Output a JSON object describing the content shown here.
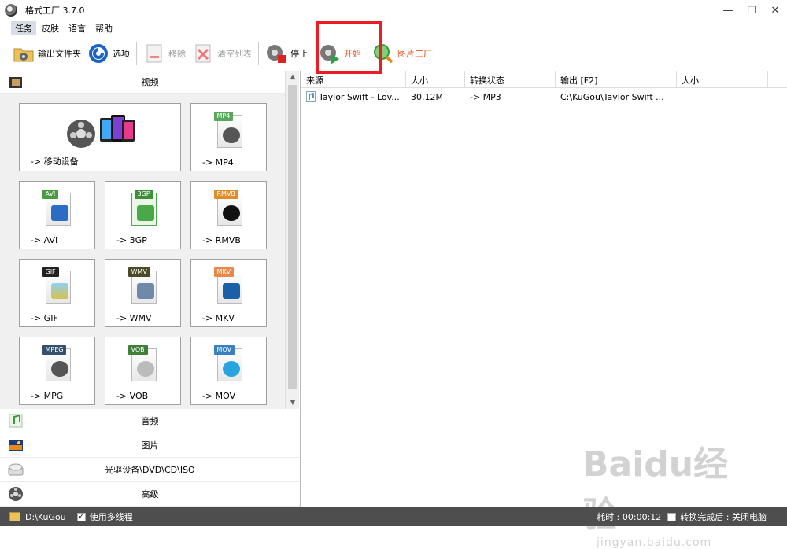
{
  "window": {
    "title": "格式工厂 3.7.0",
    "min": "—",
    "max": "☐",
    "close": "✕"
  },
  "menu": [
    "任务",
    "皮肤",
    "语言",
    "帮助"
  ],
  "toolbar": {
    "output_folder": "输出文件夹",
    "options": "选项",
    "remove": "移除",
    "clear_list": "清空列表",
    "stop": "停止",
    "start": "开始",
    "picture_factory": "图片工厂"
  },
  "left": {
    "video_header": "视频",
    "tiles": [
      {
        "label": "-> 移动设备",
        "tag": ""
      },
      {
        "label": "-> MP4",
        "tag": "MP4"
      },
      {
        "label": "-> AVI",
        "tag": "AVI"
      },
      {
        "label": "-> 3GP",
        "tag": "3GP"
      },
      {
        "label": "-> RMVB",
        "tag": "RMVB"
      },
      {
        "label": "-> GIF",
        "tag": "GIF"
      },
      {
        "label": "-> WMV",
        "tag": "WMV"
      },
      {
        "label": "-> MKV",
        "tag": "MKV"
      },
      {
        "label": "-> MPG",
        "tag": "MPEG"
      },
      {
        "label": "-> VOB",
        "tag": "VOB"
      },
      {
        "label": "-> MOV",
        "tag": "MOV"
      }
    ],
    "categories": [
      "音频",
      "图片",
      "光驱设备\\DVD\\CD\\ISO",
      "高级"
    ]
  },
  "table": {
    "headers": [
      "来源",
      "大小",
      "转换状态",
      "输出 [F2]",
      "大小"
    ],
    "rows": [
      {
        "source": "Taylor Swift - Lov...",
        "size": "30.12M",
        "status": "-> MP3",
        "output": "C:\\KuGou\\Taylor Swift ...",
        "outsize": ""
      }
    ]
  },
  "status": {
    "folder": "D:\\KuGou",
    "multithread": "使用多线程",
    "elapsed": "耗时 : 00:00:12",
    "after": "转换完成后 : 关闭电脑"
  },
  "watermark": {
    "brand": "Baidu经验",
    "url": "jingyan.baidu.com"
  },
  "colors": {
    "highlight": "#ed1c24",
    "status_bg": "#4e4e4e",
    "start_text": "#e8541a"
  }
}
